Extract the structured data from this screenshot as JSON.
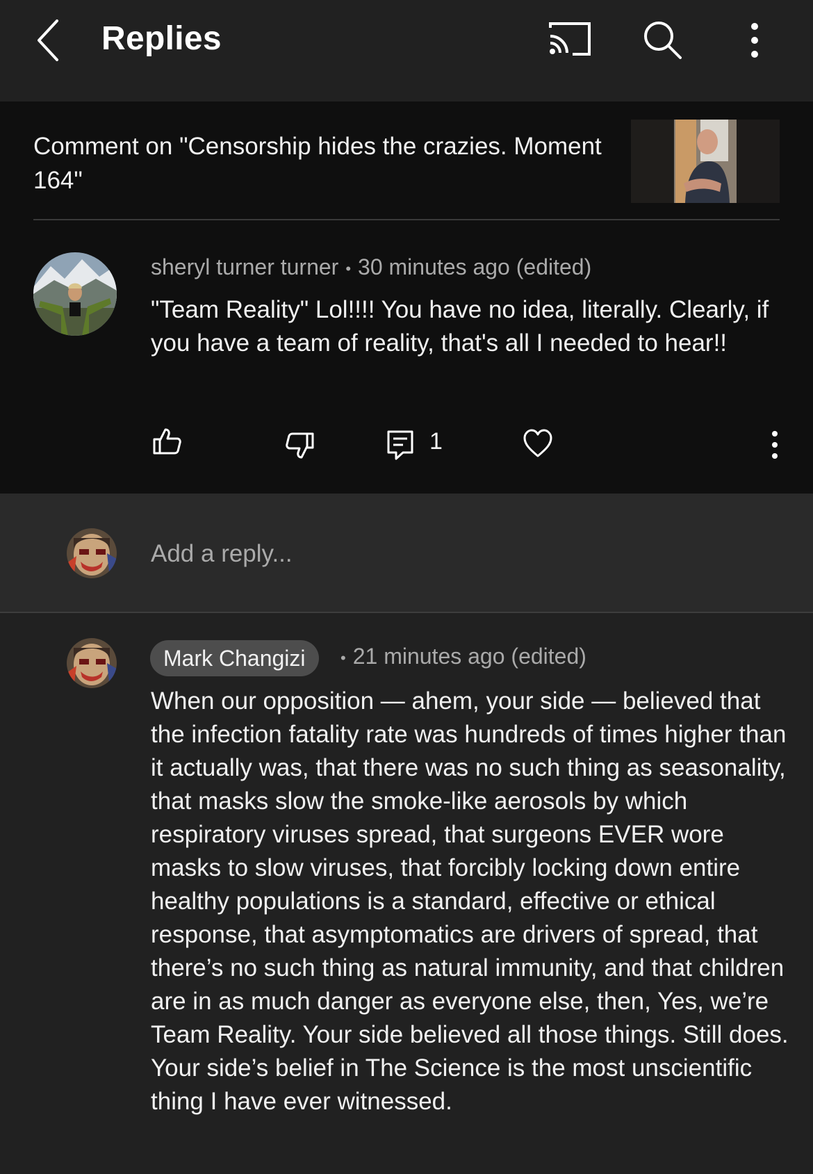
{
  "header": {
    "title": "Replies",
    "icons": [
      "back-icon",
      "cast-icon",
      "search-icon",
      "more-vert-icon"
    ]
  },
  "context": {
    "text": "Comment on \"Censorship hides the crazies. Moment 164\""
  },
  "parent_comment": {
    "author": "sheryl turner turner",
    "separator": "•",
    "time": "30 minutes ago (edited)",
    "text": "\"Team Reality\" Lol!!!! You have no idea, literally. Clearly, if you have a team of reality, that's all I needed to hear!!",
    "reply_count": "1"
  },
  "reply_input": {
    "placeholder": "Add a reply..."
  },
  "reply": {
    "author": "Mark Changizi",
    "separator": "•",
    "time": "21 minutes ago (edited)",
    "text": "When our opposition — ahem, your side — believed that the infection fatality rate was hundreds of times higher than it actually was, that there was no such thing as seasonality, that masks slow the smoke-like aerosols by which respiratory viruses spread, that surgeons EVER wore masks to slow viruses, that forcibly locking down entire healthy populations is a standard, effective or ethical response, that asymptomatics are drivers of spread, that there’s no such thing as natural immunity, and that children are in as much danger as everyone else, then, Yes, we’re Team Reality. Your side believed all those things. Still does. Your side’s belief in The Science is the most unscientific thing I have ever witnessed."
  },
  "colors": {
    "background": "#212121",
    "context_background": "#0f0f0f",
    "reply_box_background": "#2a2a2a",
    "badge_background": "#4d4d4d",
    "secondary_text": "#aaaaaa"
  }
}
